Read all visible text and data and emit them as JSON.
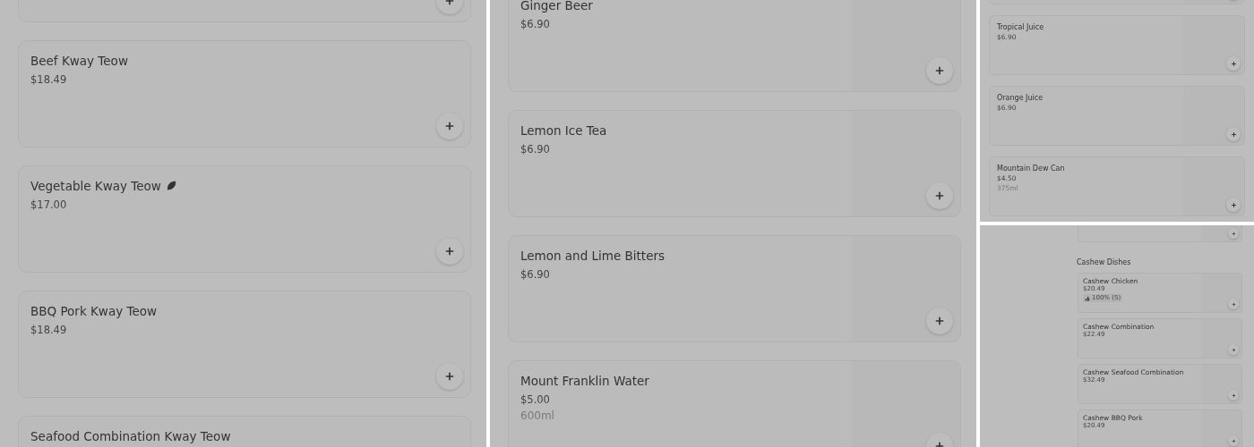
{
  "panels": [
    {
      "entries": [
        {
          "kind": "item"
        },
        {
          "kind": "item",
          "name": "Beef Kway Teow",
          "price": "$18.49"
        },
        {
          "kind": "item",
          "name": "Vegetable Kway Teow",
          "vegetarian": true,
          "price": "$17.00"
        },
        {
          "kind": "item",
          "name": "BBQ Pork Kway Teow",
          "price": "$18.49"
        },
        {
          "kind": "item",
          "name": "Seafood Combination Kway Teow",
          "add_button": false
        }
      ]
    },
    {
      "entries": [
        {
          "kind": "item",
          "name": "Ginger Beer",
          "price": "$6.90"
        },
        {
          "kind": "item",
          "name": "Lemon Ice Tea",
          "price": "$6.90"
        },
        {
          "kind": "item",
          "name": "Lemon and Lime Bitters",
          "price": "$6.90"
        },
        {
          "kind": "item",
          "name": "Mount Franklin Water",
          "price": "$5.00",
          "note": "600ml"
        }
      ]
    },
    {
      "entries": [
        {
          "kind": "item"
        },
        {
          "kind": "item",
          "name": "Tropical Juice",
          "price": "$6.90"
        },
        {
          "kind": "item",
          "name": "Orange Juice",
          "price": "$6.90"
        },
        {
          "kind": "item",
          "name": "Mountain Dew Can",
          "price": "$4.50",
          "note": "375ml"
        }
      ]
    },
    {
      "entries": [
        {
          "kind": "item"
        },
        {
          "kind": "heading",
          "title": "Cashew Dishes"
        },
        {
          "kind": "item",
          "name": "Cashew Chicken",
          "price": "$20.49",
          "rating": "100% (5)"
        },
        {
          "kind": "item",
          "name": "Cashew Combination",
          "price": "$22.49"
        },
        {
          "kind": "item",
          "name": "Cashew Seafood Combination",
          "price": "$32.49"
        },
        {
          "kind": "item",
          "name": "Cashew BBQ Pork",
          "price": "$20.49"
        }
      ]
    }
  ]
}
